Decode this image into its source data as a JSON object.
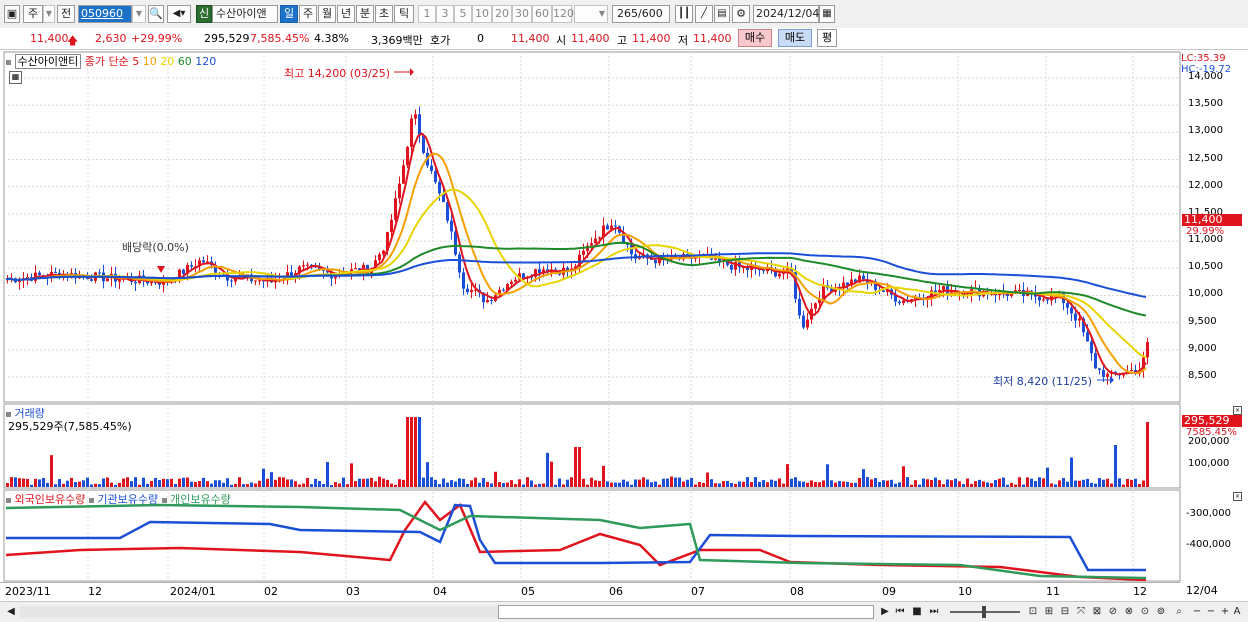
{
  "toolbar": {
    "market_label": "주",
    "prev_label": "전",
    "code_value": "050960",
    "new_label": "신",
    "stock_name": "수산아이앤",
    "period_tabs": [
      "일",
      "주",
      "월",
      "년",
      "분",
      "초",
      "틱"
    ],
    "interval_buttons": [
      "1",
      "3",
      "5",
      "10",
      "20",
      "30",
      "60",
      "120"
    ],
    "count_current": "265",
    "count_total": "/600",
    "date_value": "2024/12/04"
  },
  "quote": {
    "price": "11,400",
    "change": "2,630",
    "change_pct": "+29.99%",
    "volume": "295,529",
    "volume_ratio": "7,585.45%",
    "turnover": "4.38%",
    "amount": "3,369백만",
    "hoga_label": "호가",
    "hoga_value": "0",
    "hoga_price": "11,400",
    "open_label": "시",
    "open_value": "11,400",
    "high_label": "고",
    "high_value": "11,400",
    "low_label": "저",
    "low_value": "11,400",
    "buy_label": "매수",
    "sell_label": "매도",
    "eval_label": "평"
  },
  "price_panel": {
    "stock_label": "수산아이앤티",
    "ma_title": "종가 단순",
    "ma_periods": [
      "5",
      "10",
      "20",
      "60",
      "120"
    ],
    "ma_colors": [
      "#e0141e",
      "#f5a000",
      "#e8d400",
      "#1f8a2a",
      "#1c4fd8"
    ],
    "lc_label": "LC:35.39",
    "hc_label": "HC:-19.72",
    "high_annotation": "최고 14,200 (03/25)",
    "low_annotation": "최저 8,420 (11/25)",
    "dividend_annotation": "배당락(0.0%)",
    "current_price_tag": "11,400",
    "current_pct_tag": "29.99%",
    "y_ticks": [
      "14,000",
      "13,500",
      "13,000",
      "12,500",
      "12,000",
      "11,500",
      "11,000",
      "10,500",
      "10,000",
      "9,500",
      "9,000",
      "8,500"
    ]
  },
  "volume_panel": {
    "title": "거래량",
    "subtitle": "295,529주(7,585.45%)",
    "volume_tag": "295,529",
    "volume_pct_tag": "7585.45%",
    "y_ticks": [
      "200,000",
      "100,000"
    ]
  },
  "holding_panel": {
    "series_labels": [
      "외국인보유수량",
      "기관보유수량",
      "개인보유수량"
    ],
    "series_colors": [
      "#e0141e",
      "#1c4fd8",
      "#2f9a5a"
    ],
    "y_ticks": [
      "-300,000",
      "-400,000"
    ]
  },
  "x_axis_labels": [
    "2023/11",
    "12",
    "2024/01",
    "02",
    "03",
    "04",
    "05",
    "06",
    "07",
    "08",
    "09",
    "10",
    "11",
    "12",
    "12/04"
  ],
  "chart_data": {
    "type": "candlestick",
    "period": "daily",
    "ylim": [
      8300,
      14200
    ],
    "last_close": 11400,
    "high": {
      "value": 14200,
      "date": "03/25"
    },
    "low": {
      "value": 8420,
      "date": "11/25"
    },
    "ma_approx": {
      "ma120_last": 10080,
      "ma60_last": 9700,
      "ma20_last": 9050
    }
  }
}
